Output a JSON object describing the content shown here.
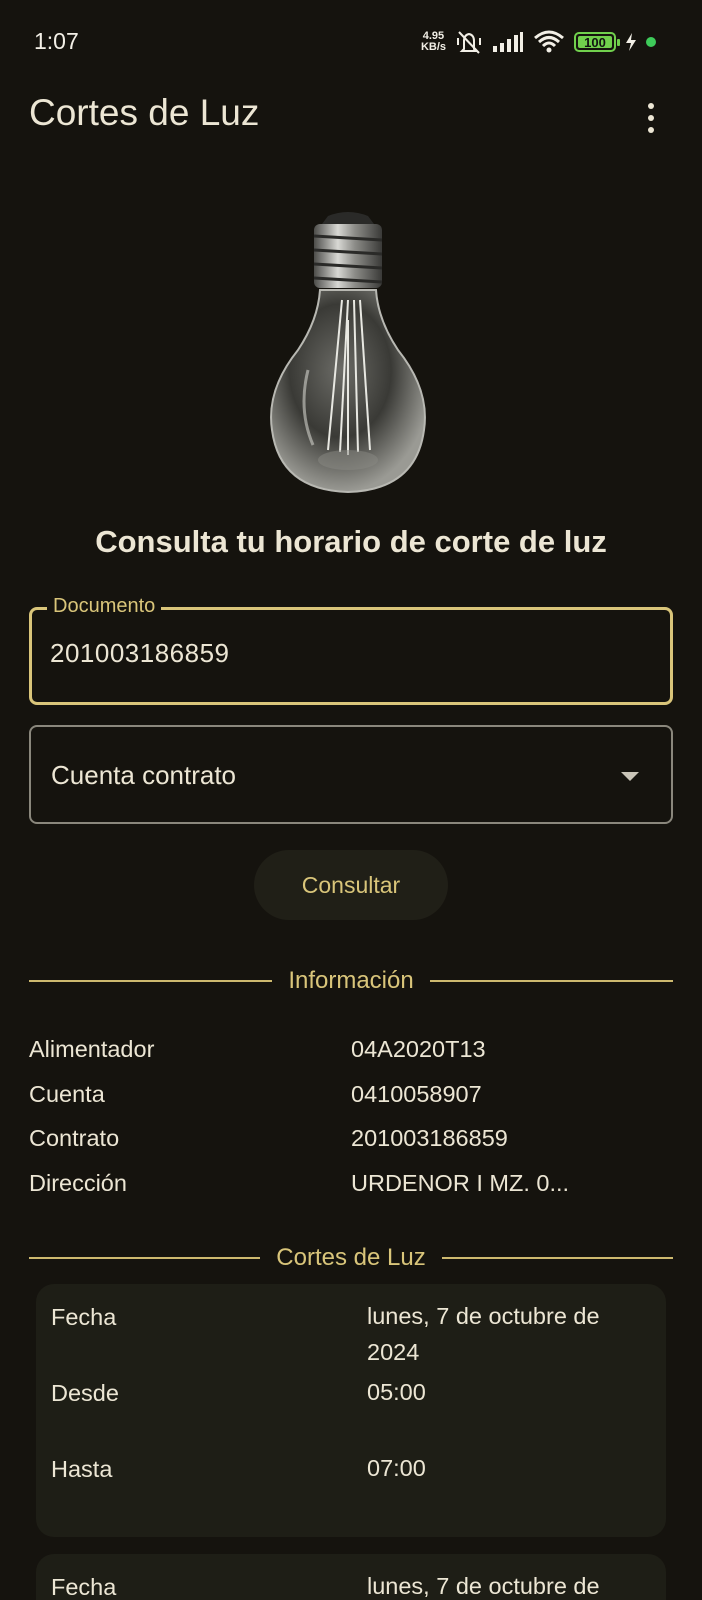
{
  "status_bar": {
    "time": "1:07",
    "net_speed_value": "4.95",
    "net_speed_unit": "KB/s",
    "battery_level": "100",
    "icons": [
      "mute-vibrate-icon",
      "signal-icon",
      "wifi-icon",
      "battery-icon",
      "charging-icon"
    ]
  },
  "app_bar": {
    "title": "Cortes de Luz",
    "menu_icon": "more-vert-icon"
  },
  "headline": "Consulta tu horario de corte de luz",
  "form": {
    "document_label": "Documento",
    "document_value": "201003186859",
    "account_select_value": "Cuenta contrato",
    "submit_label": "Consultar"
  },
  "info_section": {
    "title": "Información",
    "rows": [
      {
        "label": "Alimentador",
        "value": "04A2020T13"
      },
      {
        "label": "Cuenta",
        "value": "0410058907"
      },
      {
        "label": "Contrato",
        "value": "201003186859"
      },
      {
        "label": "Dirección",
        "value": "URDENOR I MZ. 0..."
      }
    ]
  },
  "cuts_section": {
    "title": "Cortes de Luz",
    "cards": [
      {
        "fecha_label": "Fecha",
        "fecha_value": "lunes, 7 de octubre de 2024",
        "desde_label": "Desde",
        "desde_value": "05:00",
        "hasta_label": "Hasta",
        "hasta_value": "07:00"
      },
      {
        "fecha_label": "Fecha",
        "fecha_value": "lunes, 7 de octubre de"
      }
    ]
  },
  "colors": {
    "background": "#15130e",
    "accent": "#d9c57a",
    "card": "#1e1e16",
    "text": "#ece6d4"
  }
}
